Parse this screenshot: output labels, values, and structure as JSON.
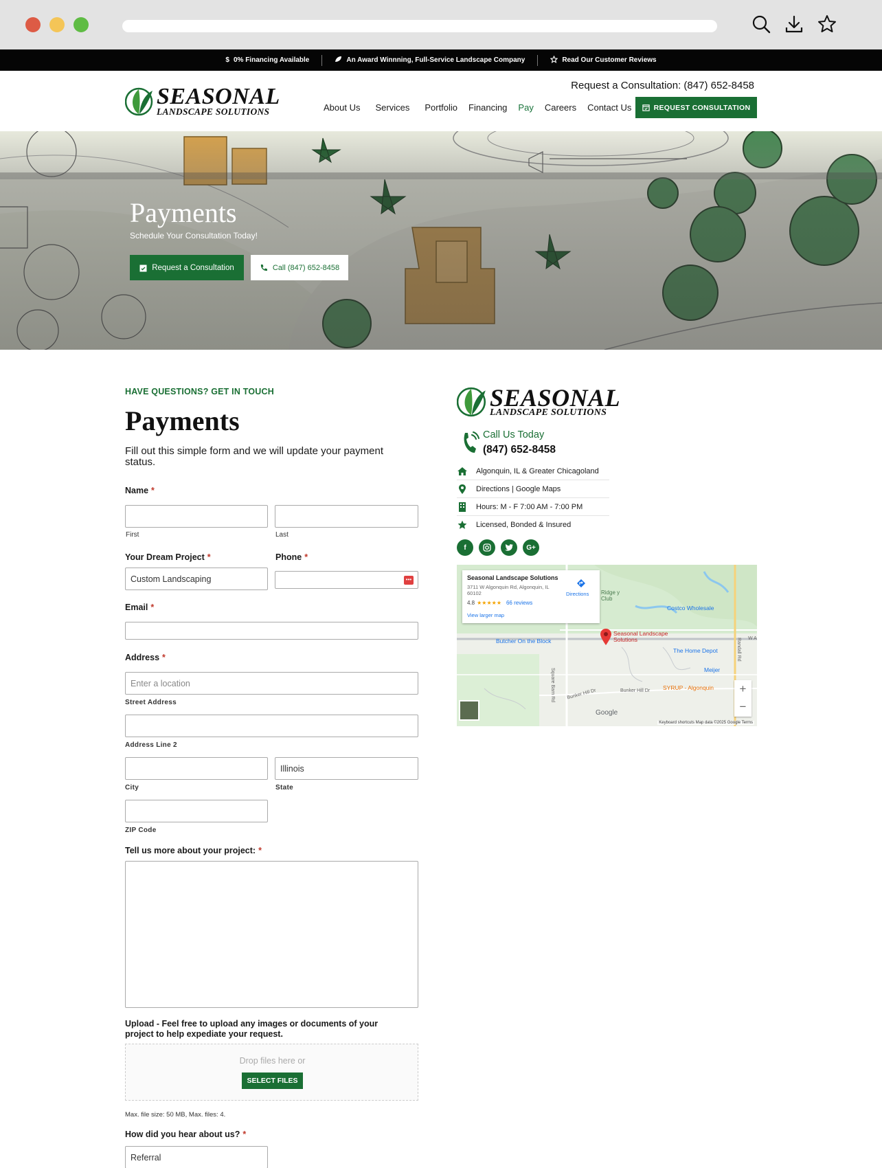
{
  "topbar": {
    "items": [
      {
        "icon": "dollar-icon",
        "text": "0% Financing Available"
      },
      {
        "icon": "leaf-icon",
        "text": "An Award Winnning, Full-Service Landscape Company"
      },
      {
        "icon": "star-outline-icon",
        "text": "Read Our Customer Reviews"
      }
    ]
  },
  "header": {
    "logo_big": "SEASONAL",
    "logo_small": "LANDSCAPE SOLUTIONS",
    "phone": "Request a Consultation: (847) 652-8458",
    "nav": [
      "About Us",
      "Services",
      "Portfolio",
      "Financing",
      "Pay",
      "Careers",
      "Contact Us"
    ],
    "active_nav": "Pay",
    "cta": "REQUEST CONSULTATION"
  },
  "hero": {
    "title": "Payments",
    "subtitle": "Schedule Your Consultation Today!",
    "btn_primary": "Request a Consultation",
    "btn_secondary": "Call (847) 652-8458"
  },
  "form": {
    "eyebrow": "HAVE QUESTIONS? GET IN TOUCH",
    "title": "Payments",
    "description": "Fill out this simple form and we will update your payment status.",
    "name_label": "Name",
    "first_sub": "First",
    "last_sub": "Last",
    "project_label": "Your Dream Project",
    "project_value": "Custom Landscaping",
    "phone_label": "Phone",
    "email_label": "Email",
    "address_label": "Address",
    "street_placeholder": "Enter a location",
    "street_sub": "Street Address",
    "line2_sub": "Address Line 2",
    "city_sub": "City",
    "state_value": "Illinois",
    "state_sub": "State",
    "zip_sub": "ZIP Code",
    "project_more_label": "Tell us more about your project:",
    "upload_label": "Upload - Feel free to upload any images or documents of your project to help expediate your request.",
    "drop_text": "Drop files here or",
    "select_files": "SELECT FILES",
    "max_note": "Max. file size: 50 MB, Max. files: 4.",
    "hear_label": "How did you hear about us?",
    "hear_value": "Referral",
    "required_mark": "*"
  },
  "info": {
    "logo_big": "SEASONAL",
    "logo_small": "LANDSCAPE SOLUTIONS",
    "call_title": "Call Us Today",
    "call_number": "(847) 652-8458",
    "rows": [
      {
        "icon": "home-icon",
        "text": "Algonquin, IL & Greater Chicagoland"
      },
      {
        "icon": "map-pin-icon",
        "text": "Directions | Google Maps"
      },
      {
        "icon": "building-icon",
        "text": "Hours: M - F 7:00 AM - 7:00 PM"
      },
      {
        "icon": "star-icon",
        "text": "Licensed, Bonded & Insured"
      }
    ],
    "socials": [
      "facebook-icon",
      "instagram-icon",
      "twitter-icon",
      "google-plus-icon"
    ]
  },
  "map": {
    "business_name": "Seasonal Landscape Solutions",
    "address": "3711 W Algonquin Rd, Algonquin, IL 60102",
    "rating": "4.8",
    "stars": "★★★★★",
    "reviews": "66 reviews",
    "view_larger": "View larger map",
    "directions": "Directions",
    "pin_label": "Seasonal Landscape Solutions",
    "places": [
      "Ridge y Club",
      "Costco Wholesale",
      "Butcher On the Block",
      "The Home Depot",
      "Meijer",
      "SYRUP - Algonquin",
      "Square Barn Rd",
      "Bunker Hill Dr",
      "Bunker Hill Dr",
      "Randall Rd",
      "W A"
    ],
    "footer": "Keyboard shortcuts   Map data ©2025 Google   Terms",
    "google": "Google"
  }
}
